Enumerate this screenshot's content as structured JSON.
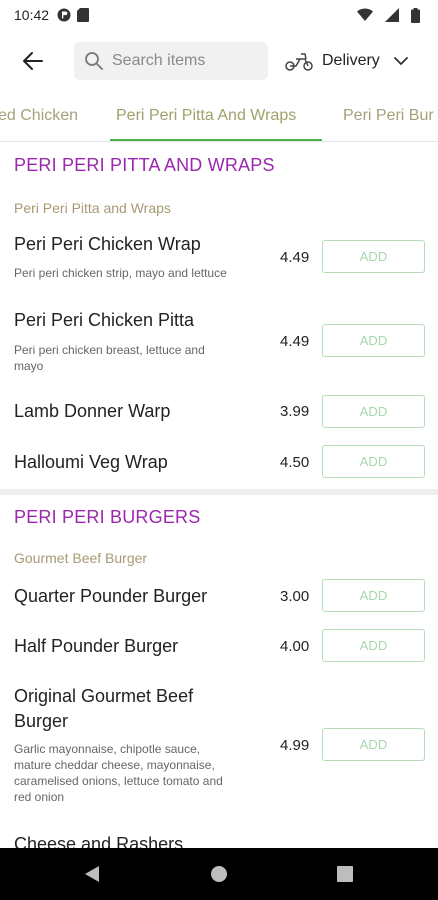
{
  "status_bar": {
    "time": "10:42"
  },
  "toolbar": {
    "search_placeholder": "Search items",
    "delivery_label": "Delivery"
  },
  "tabs": [
    {
      "label": "ed Chicken"
    },
    {
      "label": "Peri Peri Pitta And Wraps"
    },
    {
      "label": "Peri Peri Bur"
    }
  ],
  "sections": [
    {
      "title": "PERI PERI PITTA AND WRAPS",
      "subtitle": "Peri Peri Pitta and Wraps",
      "items": [
        {
          "name": "Peri Peri Chicken Wrap",
          "desc": "Peri peri chicken strip, mayo and lettuce",
          "price": "4.49",
          "add": "ADD"
        },
        {
          "name": "Peri Peri Chicken Pitta",
          "desc_line1": "Peri peri chicken breast, lettuce and",
          "desc_line2": "mayo",
          "price": "4.49",
          "add": "ADD"
        },
        {
          "name": "Lamb Donner Warp",
          "price": "3.99",
          "add": "ADD"
        },
        {
          "name": "Halloumi Veg Wrap",
          "price": "4.50",
          "add": "ADD"
        }
      ]
    },
    {
      "title": "PERI PERI BURGERS",
      "subtitle": "Gourmet Beef Burger",
      "items": [
        {
          "name": "Quarter Pounder Burger",
          "price": "3.00",
          "add": "ADD"
        },
        {
          "name": "Half Pounder Burger",
          "price": "4.00",
          "add": "ADD"
        },
        {
          "name_line1": "Original Gourmet Beef",
          "name_line2": "Burger",
          "desc_line1": "Garlic mayonnaise, chipotle sauce,",
          "desc_line2": "mature cheddar cheese, mayonnaise,",
          "desc_line3": "caramelised onions, lettuce tomato and",
          "desc_line4": "red onion",
          "price": "4.99",
          "add": "ADD"
        },
        {
          "name": "Cheese and Rashers"
        }
      ]
    }
  ]
}
